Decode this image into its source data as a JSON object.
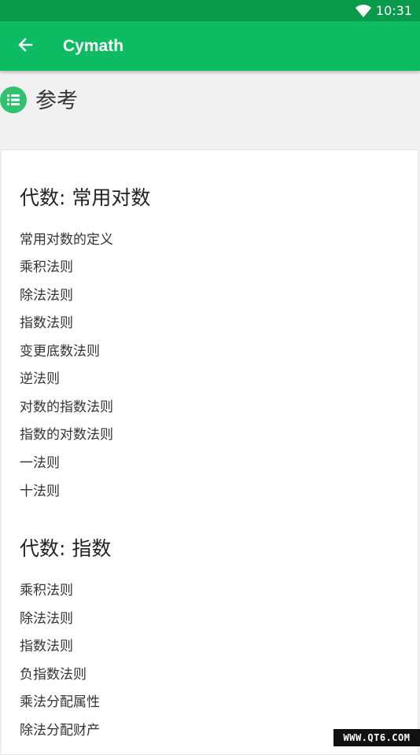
{
  "status_bar": {
    "time": "10:31"
  },
  "app_bar": {
    "title": "Cymath"
  },
  "section": {
    "title": "参考"
  },
  "groups": [
    {
      "title": "代数: 常用对数",
      "items": [
        "常用对数的定义",
        "乘积法则",
        "除法法则",
        "指数法则",
        "变更底数法则",
        "逆法则",
        "对数的指数法则",
        "指数的对数法则",
        "一法则",
        "十法则"
      ]
    },
    {
      "title": "代数: 指数",
      "items": [
        "乘积法则",
        "除法法则",
        "指数法则",
        "负指数法则",
        "乘法分配属性",
        "除法分配财产"
      ]
    }
  ],
  "watermark": "WWW.QT6.COM",
  "colors": {
    "status_bar": "#0a9a4c",
    "app_bar": "#0dbb62",
    "accent_icon": "#2fc26f"
  },
  "icons": {
    "back": "arrow-left-icon",
    "section": "list-icon",
    "wifi": "wifi-icon"
  }
}
